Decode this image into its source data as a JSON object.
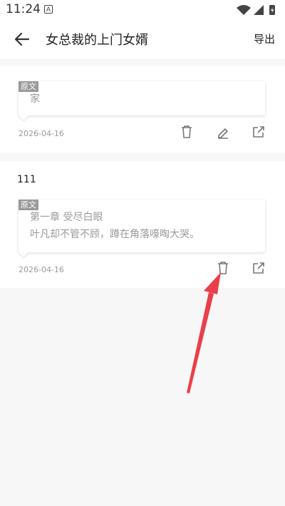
{
  "status_bar": {
    "time": "11:24",
    "indicator": "A"
  },
  "app_bar": {
    "title": "女总裁的上门女婿",
    "export_label": "导出"
  },
  "notes": [
    {
      "title": "",
      "quote_tag": "原文",
      "quote_lines": [
        "家"
      ],
      "date": "2026-04-16",
      "actions": [
        "trash-icon",
        "edit-icon",
        "share-icon"
      ]
    },
    {
      "title": "111",
      "quote_tag": "原文",
      "quote_lines": [
        "第一章 受尽白眼",
        "叶凡却不管不顾，蹲在角落嚎啕大哭。"
      ],
      "date": "2026-04-16",
      "actions": [
        "trash-icon",
        "share-icon"
      ]
    }
  ],
  "colors": {
    "annotation_arrow": "#e8404a",
    "quote_text": "#9a9a9a"
  }
}
